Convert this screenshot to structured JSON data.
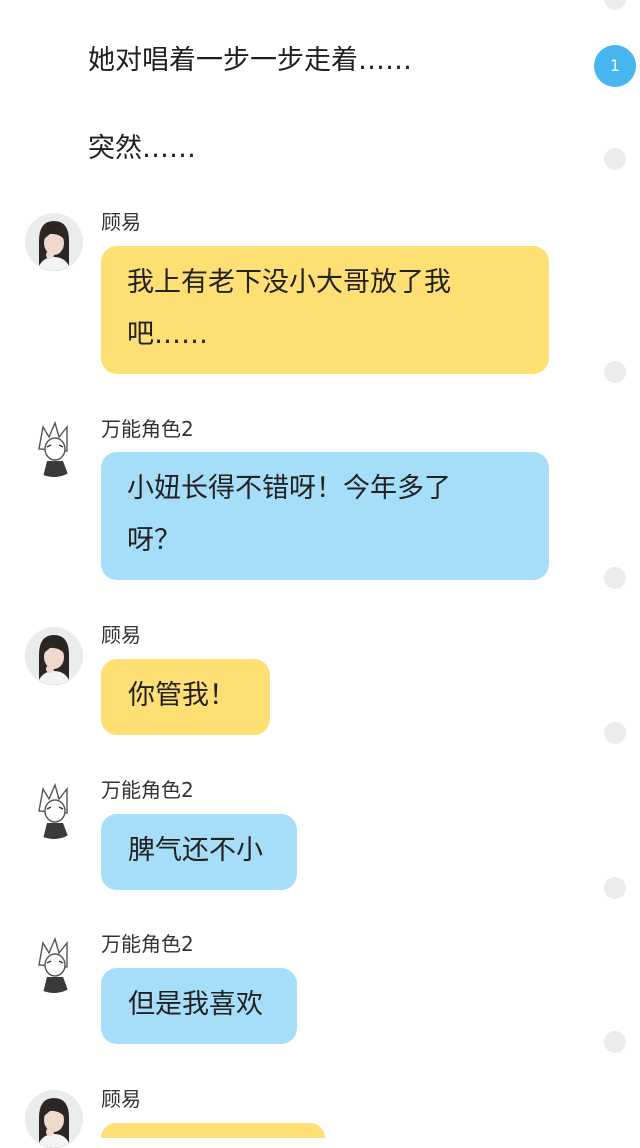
{
  "narrations": [
    "她对唱着一步一步走着……",
    "突然……"
  ],
  "messages": [
    {
      "speaker": "顾易",
      "text": "我上有老下没小大哥放了我\n吧……",
      "color": "#fddf74"
    },
    {
      "speaker": "万能角色2",
      "text": "小妞长得不错呀！今年多了\n呀？",
      "color": "#a6def9"
    },
    {
      "speaker": "顾易",
      "text": "你管我！",
      "color": "#fddf74"
    },
    {
      "speaker": "万能角色2",
      "text": "脾气还不小",
      "color": "#a6def9"
    },
    {
      "speaker": "万能角色2",
      "text": "但是我喜欢",
      "color": "#a6def9"
    },
    {
      "speaker": "顾易",
      "text": "",
      "color": "#fddf74"
    }
  ],
  "badge_count": "1",
  "icons": {
    "avatar_girl": "girl-avatar-icon",
    "avatar_anime": "anime-character-avatar-icon"
  },
  "colors": {
    "yellow_bubble": "#fddf74",
    "blue_bubble": "#a6def9",
    "badge": "#45b7ee",
    "dot": "#ececec"
  }
}
